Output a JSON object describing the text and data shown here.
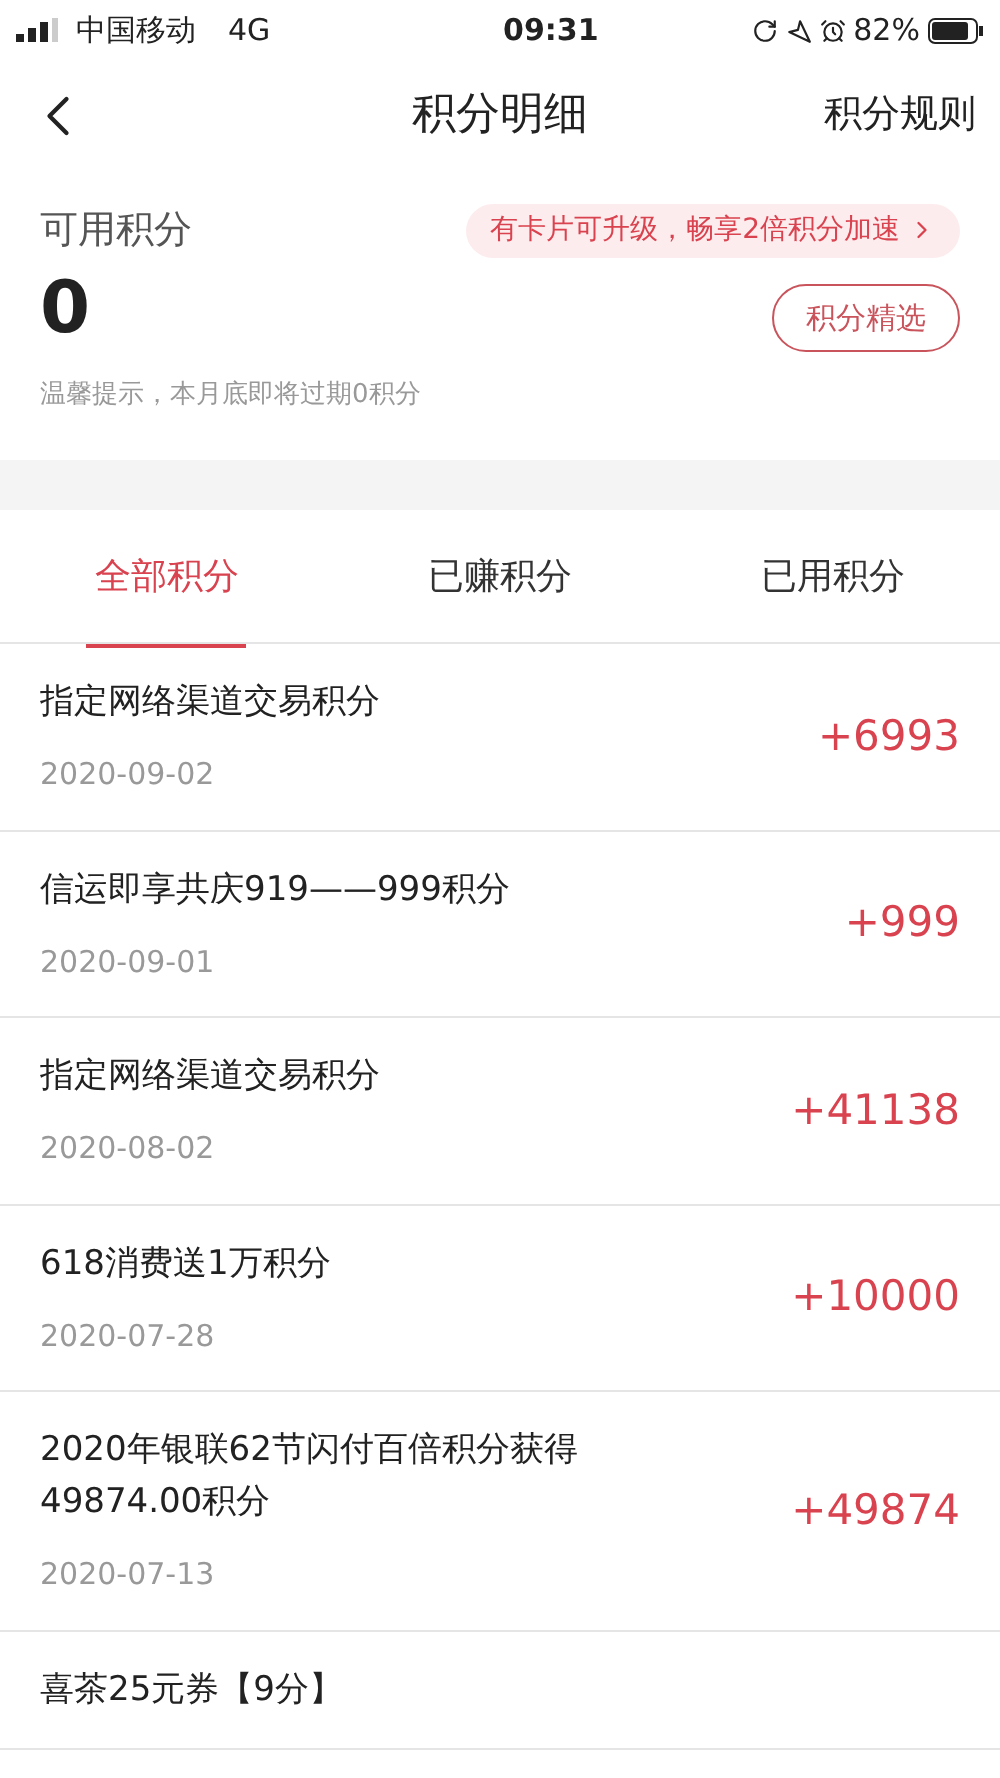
{
  "status_bar": {
    "carrier": "中国移动",
    "network": "4G",
    "time": "09:31",
    "battery": "82%"
  },
  "nav": {
    "title": "积分明细",
    "action": "积分规则"
  },
  "summary": {
    "label": "可用积分",
    "value": "0",
    "promo": "有卡片可升级，畅享2倍积分加速",
    "button": "积分精选",
    "tip": "温馨提示，本月底即将过期0积分"
  },
  "tabs": [
    {
      "label": "全部积分",
      "selected": true
    },
    {
      "label": "已赚积分",
      "selected": false
    },
    {
      "label": "已用积分",
      "selected": false
    }
  ],
  "records": [
    {
      "title": "指定网络渠道交易积分",
      "date": "2020-09-02",
      "amount": "+6993"
    },
    {
      "title": "信运即享共庆919——999积分",
      "date": "2020-09-01",
      "amount": "+999"
    },
    {
      "title": "指定网络渠道交易积分",
      "date": "2020-08-02",
      "amount": "+41138"
    },
    {
      "title": "618消费送1万积分",
      "date": "2020-07-28",
      "amount": "+10000"
    },
    {
      "title": "2020年银联62节闪付百倍积分获得49874.00积分",
      "date": "2020-07-13",
      "amount": "+49874"
    },
    {
      "title": "喜茶25元券【9分】"
    }
  ]
}
